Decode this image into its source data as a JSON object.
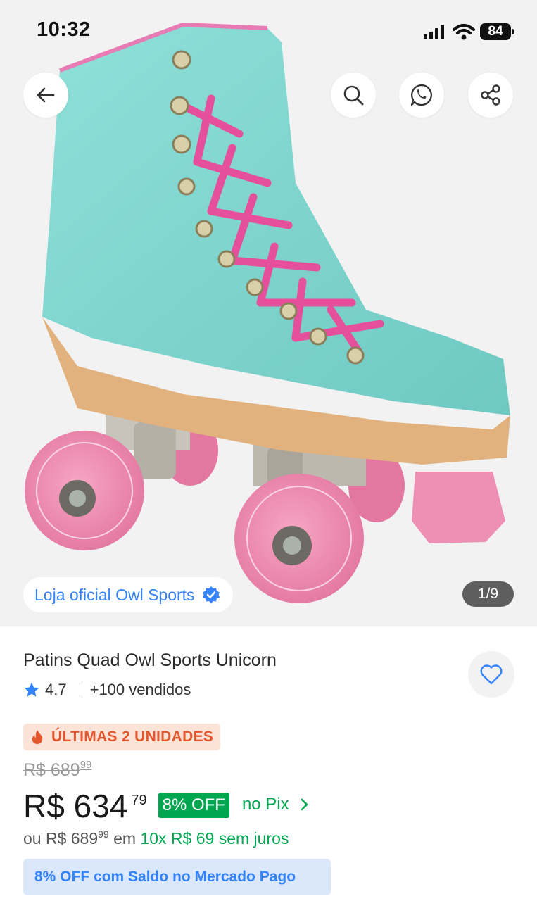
{
  "status_bar": {
    "time": "10:32",
    "battery": "84"
  },
  "header_buttons": {
    "back_icon": "arrow-left-icon",
    "search_icon": "search-icon",
    "whatsapp_icon": "whatsapp-icon",
    "share_icon": "share-icon"
  },
  "gallery": {
    "store_label": "Loja oficial Owl Sports",
    "page_counter": "1/9"
  },
  "product": {
    "title": "Patins Quad Owl Sports Unicorn",
    "rating": "4.7",
    "sold": "+100 vendidos",
    "urgency": "ÚLTIMAS 2 UNIDADES",
    "old_price_int": "R$ 689",
    "old_price_cents": "99",
    "price_int": "R$ 634",
    "price_cents": "79",
    "discount": "8% OFF",
    "pix_label": "no Pix",
    "installments_prefix": "ou R$ 689",
    "installments_cents": "99",
    "installments_mid": "em",
    "installments_green": "10x R$ 69 sem juros",
    "mp_banner": "8% OFF com Saldo no Mercado Pago"
  },
  "colors": {
    "accent_blue": "#3483fa",
    "green": "#00a650",
    "urgency_orange": "#e4572e",
    "skate_body": "#7fd6cf",
    "laces_pink": "#e64f9b",
    "wheel_pink": "#f28bb2"
  }
}
